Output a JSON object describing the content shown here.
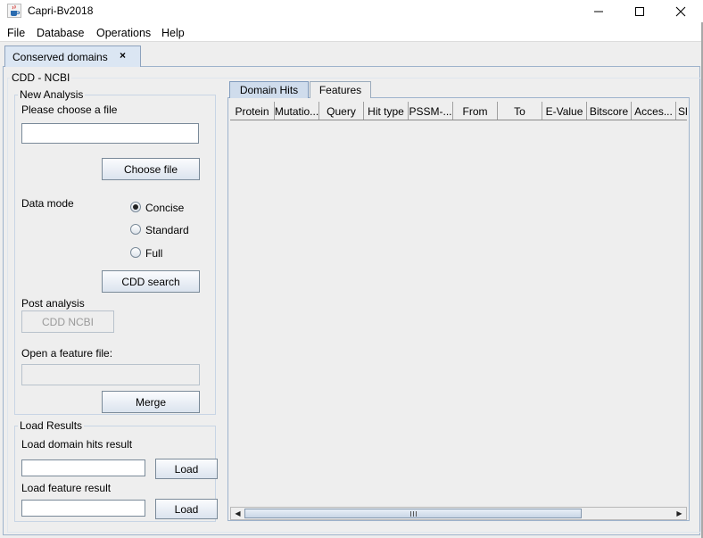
{
  "window": {
    "title": "Capri-Bv2018",
    "icon": "java-cup-icon",
    "controls": {
      "minimize": "—",
      "maximize": "☐",
      "close": "✕"
    }
  },
  "menu": [
    "File",
    "Database",
    "Operations",
    "Help"
  ],
  "outer_tab": {
    "label": "Conserved domains",
    "close": "×"
  },
  "cdd_group": {
    "label": "CDD - NCBI"
  },
  "new_analysis": {
    "legend": "New Analysis",
    "choose_label": "Please choose a file",
    "file_value": "",
    "choose_button": "Choose file",
    "data_mode_label": "Data mode",
    "modes": [
      "Concise",
      "Standard",
      "Full"
    ],
    "selected_mode": "Concise",
    "search_button": "CDD search",
    "post_label": "Post analysis",
    "post_button": "CDD NCBI",
    "feature_label": "Open a feature file:",
    "feature_value": "",
    "merge_button": "Merge"
  },
  "load_results": {
    "legend": "Load Results",
    "domain_label": "Load domain hits result",
    "domain_value": "",
    "feature_label": "Load feature result",
    "feature_value": "",
    "load_button": "Load"
  },
  "tabs": [
    "Domain Hits",
    "Features"
  ],
  "active_tab": "Domain Hits",
  "table": {
    "columns": [
      "Protein",
      "Mutatio...",
      "Query",
      "Hit type",
      "PSSM-...",
      "From",
      "To",
      "E-Value",
      "Bitscore",
      "Acces...",
      "Sh"
    ],
    "rows": []
  },
  "scrollbar": {
    "left_arrow": "◀",
    "right_arrow": "▶"
  }
}
